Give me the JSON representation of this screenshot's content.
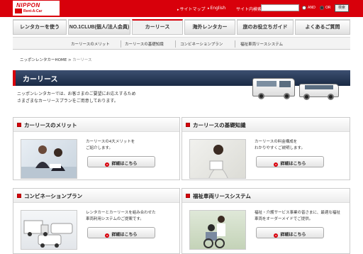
{
  "brand": {
    "logo_main": "NIPPON",
    "logo_sub": "Rent-A-Car"
  },
  "topbar": {
    "sitemap": "サイトマップ",
    "english": "English",
    "search_label": "サイト内検索",
    "search_value": "",
    "radio_and": "AND",
    "radio_or": "OR",
    "search_button": "検索"
  },
  "nav": {
    "tabs": [
      {
        "label": "レンタカーを使う"
      },
      {
        "label": "NO.1CLUB(個人/法人会員)"
      },
      {
        "label": "カーリース"
      },
      {
        "label": "海外レンタカー"
      },
      {
        "label": "旅のお役立ちガイド"
      },
      {
        "label": "よくあるご質問"
      }
    ],
    "active_index": 2
  },
  "subnav": {
    "items": [
      {
        "label": "カーリースのメリット"
      },
      {
        "label": "カーリースの基礎知識"
      },
      {
        "label": "コンビネーションプラン"
      },
      {
        "label": "福祉車両リースシステム"
      }
    ]
  },
  "breadcrumb": {
    "home": "ニッポンレンタカーHOME",
    "sep": ">",
    "current": "カーリース"
  },
  "page": {
    "title": "カーリース",
    "intro_1": "ニッポンレンタカーでは、お客さまのご要望にお応えするため",
    "intro_2": "さまざまなカーリースプランをご用意しております。"
  },
  "cards": [
    {
      "title": "カーリースのメリット",
      "text_1": "カーリースの4大メリットを",
      "text_2": "ご紹介します。",
      "button": "詳細はこちら"
    },
    {
      "title": "カーリースの基礎知識",
      "text_1": "カーリースの料金構成を",
      "text_2": "わかりやすくご説明します。",
      "button": "詳細はこちら"
    },
    {
      "title": "コンビネーションプラン",
      "text_1": "レンタカーとカーリースを組み合わせた",
      "text_2": "車両利用システムのご提案です。",
      "button": "詳細はこちら"
    },
    {
      "title": "福祉車両リースシステム",
      "text_1": "福祉・介護サービス事業の皆さまに、最適な福祉",
      "text_2": "車両をオーダーメイドでご提供。",
      "button": "詳細はこちら"
    }
  ],
  "colors": {
    "brand_red": "#d8000b",
    "title_navy": "#2a3b5a"
  }
}
